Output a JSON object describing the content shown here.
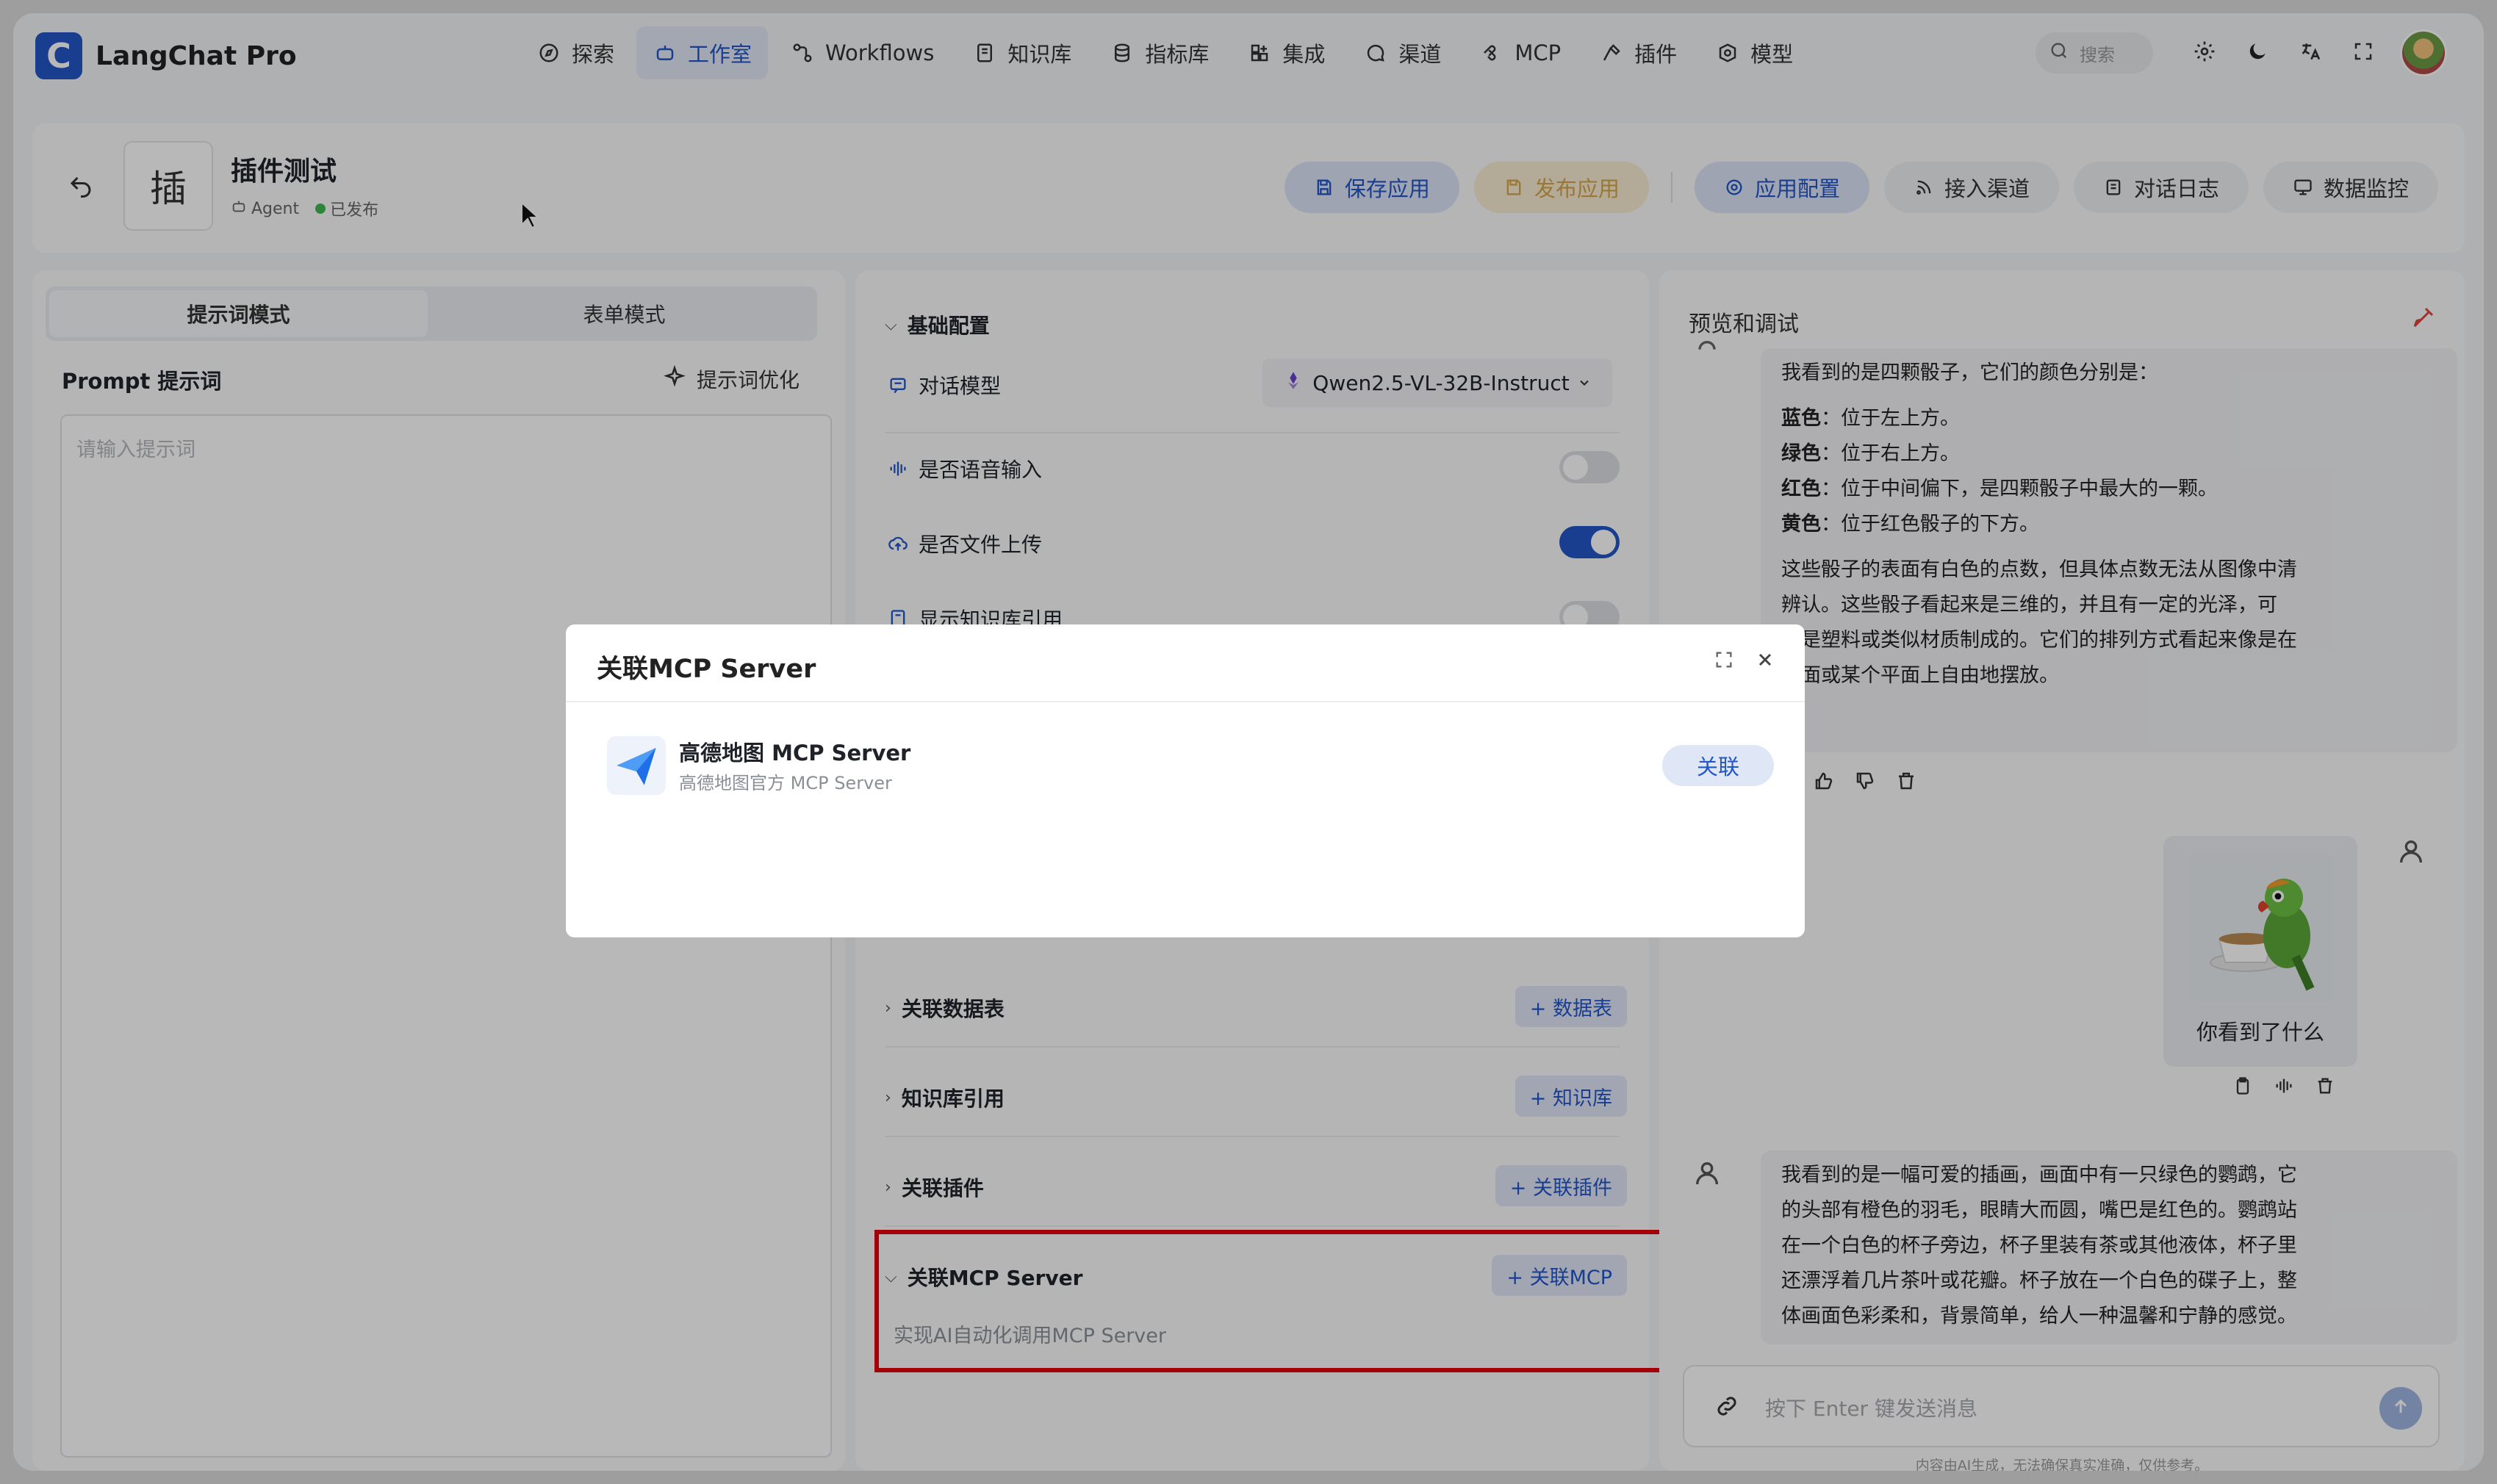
{
  "brand": {
    "logo_letter": "C",
    "name": "LangChat Pro"
  },
  "nav": {
    "items": [
      {
        "label": "探索",
        "icon": "compass-icon"
      },
      {
        "label": "工作室",
        "icon": "robot-icon",
        "active": true
      },
      {
        "label": "Workflows",
        "icon": "workflow-icon"
      },
      {
        "label": "知识库",
        "icon": "book-icon"
      },
      {
        "label": "指标库",
        "icon": "database-icon"
      },
      {
        "label": "集成",
        "icon": "grid-plus-icon"
      },
      {
        "label": "渠道",
        "icon": "chat-icon"
      },
      {
        "label": "MCP",
        "icon": "mcp-icon"
      },
      {
        "label": "插件",
        "icon": "hammer-icon"
      },
      {
        "label": "模型",
        "icon": "model-icon"
      }
    ],
    "search_placeholder": "搜索"
  },
  "header": {
    "avatar_text": "插",
    "title": "插件测试",
    "type": "Agent",
    "status": "已发布",
    "buttons": {
      "save": "保存应用",
      "publish": "发布应用",
      "config": "应用配置",
      "channel": "接入渠道",
      "log": "对话日志",
      "monitor": "数据监控"
    }
  },
  "left": {
    "tabs": [
      "提示词模式",
      "表单模式"
    ],
    "prompt_label": "Prompt 提示词",
    "optimize_label": "提示词优化",
    "prompt_placeholder": "请输入提示词"
  },
  "middle": {
    "basic_section": "基础配置",
    "model_label": "对话模型",
    "model_value": "Qwen2.5-VL-32B-Instruct",
    "voice_input": {
      "label": "是否语音输入",
      "on": false
    },
    "file_upload": {
      "label": "是否文件上传",
      "on": true
    },
    "show_kb": {
      "label": "显示知识库引用",
      "on": false
    },
    "sections": [
      {
        "label": "关联数据表",
        "button": "+ 数据表"
      },
      {
        "label": "知识库引用",
        "button": "+ 知识库"
      },
      {
        "label": "关联插件",
        "button": "+ 关联插件"
      }
    ],
    "mcp_section": {
      "label": "关联MCP Server",
      "button": "+ 关联MCP",
      "desc": "实现AI自动化调用MCP Server"
    }
  },
  "right": {
    "title": "预览和调试",
    "assistant_msg_1": {
      "intro": "我看到的是四颗骰子，它们的颜色分别是：",
      "items": [
        {
          "color": "蓝色",
          "text": "：位于左上方。"
        },
        {
          "color": "绿色",
          "text": "：位于右上方。"
        },
        {
          "color": "红色",
          "text": "：位于中间偏下，是四颗骰子中最大的一颗。"
        },
        {
          "color": "黄色",
          "text": "：位于红色骰子的下方。"
        }
      ],
      "para": [
        "这些骰子的表面有白色的点数，但具体点数无法从图像中清",
        "辨认。这些骰子看起来是三维的，并且有一定的光泽，可",
        "能是塑料或类似材质制成的。它们的排列方式看起来像是在",
        "桌面或某个平面上自由地摆放。"
      ]
    },
    "user_msg": "你看到了什么",
    "assistant_msg_2": [
      "我看到的是一幅可爱的插画，画面中有一只绿色的鹦鹉，它",
      "的头部有橙色的羽毛，眼睛大而圆，嘴巴是红色的。鹦鹉站",
      "在一个白色的杯子旁边，杯子里装有茶或其他液体，杯子里",
      "还漂浮着几片茶叶或花瓣。杯子放在一个白色的碟子上，整",
      "体画面色彩柔和，背景简单，给人一种温馨和宁静的感觉。"
    ],
    "input_placeholder": "按下 Enter 键发送消息",
    "disclaimer": "内容由AI生成，无法确保真实准确，仅供参考。"
  },
  "modal": {
    "title": "关联MCP Server",
    "server_name": "高德地图 MCP Server",
    "server_desc": "高德地图官方 MCP Server",
    "link_button": "关联"
  },
  "colors": {
    "accent": "#2356c7",
    "highlight": "#e3000f",
    "publish": "#d6a64a"
  }
}
